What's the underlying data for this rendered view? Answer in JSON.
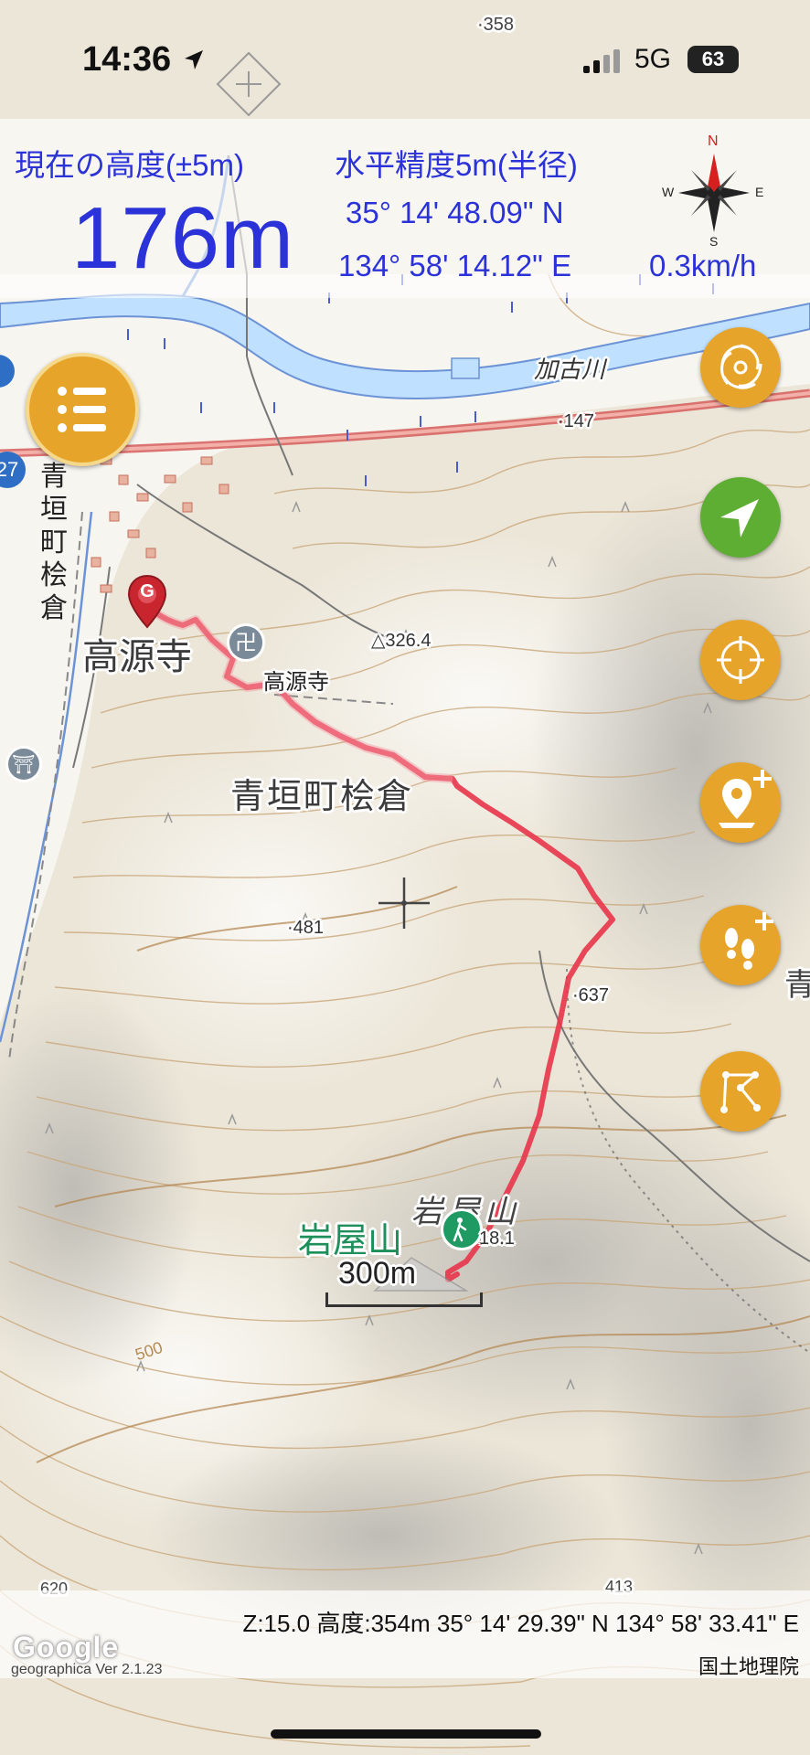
{
  "status_bar": {
    "time": "14:36",
    "network": "5G",
    "battery": "63"
  },
  "hud": {
    "altitude_label": "現在の高度(±5m)",
    "altitude_value": "176m",
    "accuracy_label": "水平精度5m(半径)",
    "latitude": "35° 14' 48.09\" N",
    "longitude": "134° 58' 14.12\" E",
    "speed": "0.3km/h",
    "compass": {
      "north": "N",
      "south": "S",
      "east": "E",
      "west": "W"
    }
  },
  "map": {
    "labels": {
      "temple_big": "高源寺",
      "temple_small": "高源寺",
      "area_name": "青垣町桧倉",
      "area_vertical": "青垣町桧倉",
      "river": "加古川",
      "peak": "岩屋山",
      "peak_overlay": "岩屋山",
      "elev_326": "326.4",
      "elev_147": "147",
      "elev_481": "481",
      "elev_637": "637",
      "elev_718": "18.1",
      "elev_620": "620",
      "elev_413": "413",
      "elev_358": "358",
      "route_no": "27",
      "edge_char": "青",
      "contour_500": "500",
      "scale": "300m",
      "start_marker": "G"
    },
    "route_color": "#e8354a",
    "accent_orange": "#e7a42a",
    "accent_green": "#5fae34"
  },
  "controls": {
    "menu_icon": "menu-list-icon",
    "buttons": [
      {
        "name": "layers-button",
        "icon": "spiral-icon"
      },
      {
        "name": "current-location-button",
        "icon": "navigation-arrow-icon"
      },
      {
        "name": "crosshair-button",
        "icon": "crosshair-icon"
      },
      {
        "name": "add-marker-button",
        "icon": "add-pin-icon"
      },
      {
        "name": "start-track-button",
        "icon": "footprint-add-icon"
      },
      {
        "name": "route-button",
        "icon": "route-icon"
      }
    ]
  },
  "bottom_bar": {
    "info": "Z:15.0 高度:354m  35° 14' 29.39\" N 134° 58' 33.41\" E",
    "credit": "国土地理院",
    "version": "geographica Ver 2.1.23",
    "google": "Google"
  }
}
